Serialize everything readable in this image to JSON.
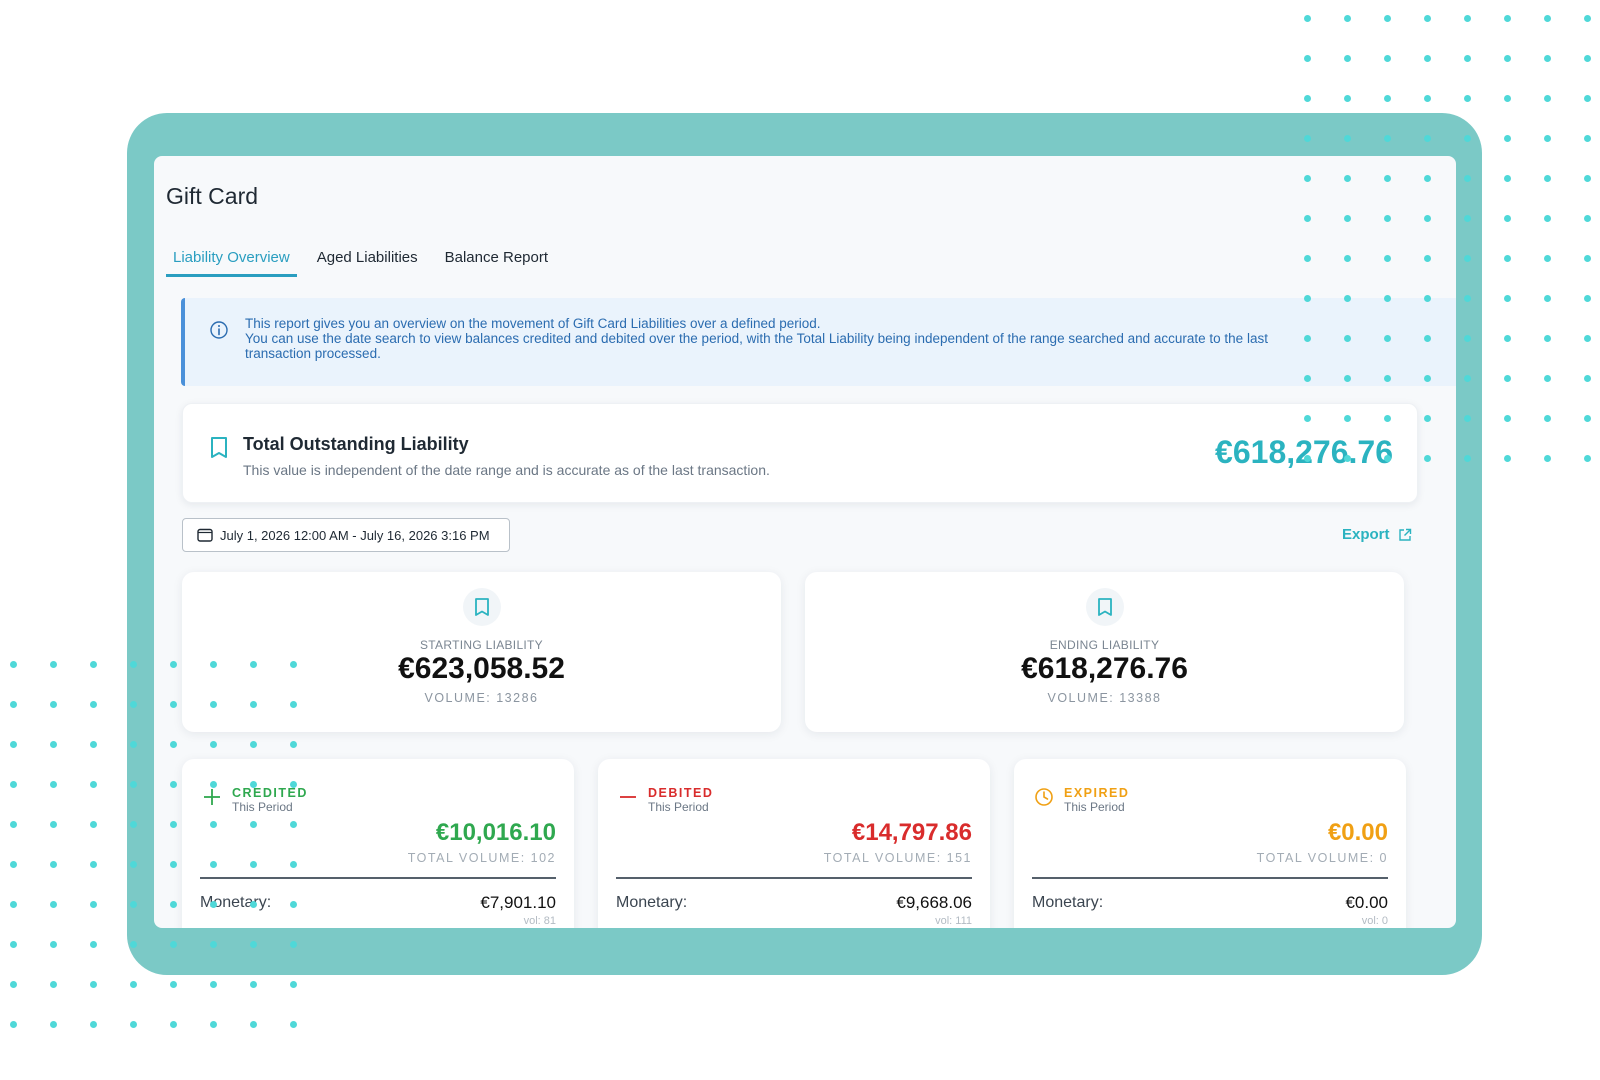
{
  "page": {
    "title": "Gift Card"
  },
  "tabs": [
    {
      "label": "Liability Overview",
      "active": true
    },
    {
      "label": "Aged Liabilities",
      "active": false
    },
    {
      "label": "Balance Report",
      "active": false
    }
  ],
  "info_banner": {
    "line1": "This report gives you an overview on the movement of Gift Card Liabilities over a defined period.",
    "line2": "You can use the date search to view balances credited and debited over the period, with the Total Liability being independent of the range searched and accurate to the last",
    "line3": "transaction processed."
  },
  "total_liability": {
    "title": "Total Outstanding Liability",
    "subtitle": "This value is independent of the date range and is accurate as of the last transaction.",
    "value": "€618,276.76"
  },
  "date_range": {
    "label": "July 1, 2026 12:00 AM - July 16, 2026 3:16 PM"
  },
  "export": {
    "label": "Export"
  },
  "starting": {
    "label": "STARTING LIABILITY",
    "value": "€623,058.52",
    "volume": "VOLUME: 13286"
  },
  "ending": {
    "label": "ENDING LIABILITY",
    "value": "€618,276.76",
    "volume": "VOLUME: 13388"
  },
  "period_cards": {
    "credited": {
      "label": "CREDITED",
      "sub": "This Period",
      "value": "€10,016.10",
      "volume": "TOTAL VOLUME: 102",
      "row_label": "Monetary:",
      "row_value": "€7,901.10",
      "row_vol": "vol: 81"
    },
    "debited": {
      "label": "DEBITED",
      "sub": "This Period",
      "value": "€14,797.86",
      "volume": "TOTAL VOLUME: 151",
      "row_label": "Monetary:",
      "row_value": "€9,668.06",
      "row_vol": "vol: 111"
    },
    "expired": {
      "label": "EXPIRED",
      "sub": "This Period",
      "value": "€0.00",
      "volume": "TOTAL VOLUME: 0",
      "row_label": "Monetary:",
      "row_value": "€0.00",
      "row_vol": "vol: 0"
    }
  },
  "colors": {
    "frame": "#7bc9c6",
    "accent": "#2bb3c0",
    "tab_active": "#2a9ec0",
    "info": "#2b6cb0",
    "credited": "#2fa84f",
    "debited": "#d92c2c",
    "expired": "#f0a014",
    "dots": "#4fd8d8"
  },
  "icons": {
    "info": "info-circle-icon",
    "liability": "bookmark-icon",
    "calendar": "calendar-icon",
    "export": "external-link-icon",
    "credited": "plus-icon",
    "debited": "minus-icon",
    "expired": "clock-icon"
  }
}
